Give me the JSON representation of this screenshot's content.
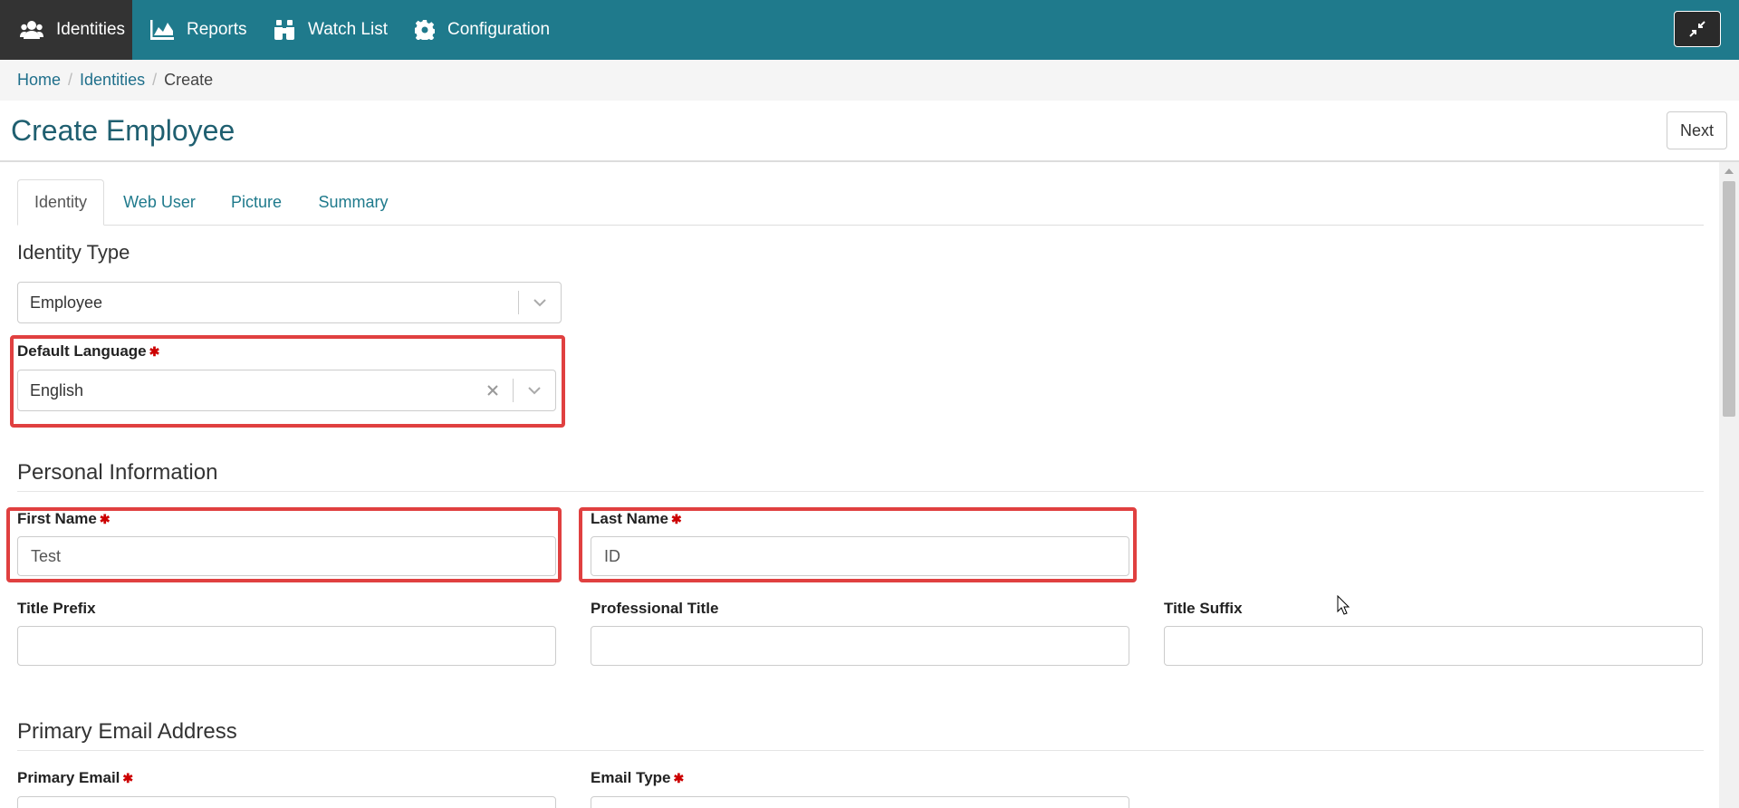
{
  "nav": {
    "items": [
      {
        "label": "Identities",
        "icon": "users-icon"
      },
      {
        "label": "Reports",
        "icon": "area-chart-icon"
      },
      {
        "label": "Watch List",
        "icon": "binoculars-icon"
      },
      {
        "label": "Configuration",
        "icon": "gear-icon"
      }
    ],
    "collapse_icon": "compress-icon"
  },
  "breadcrumb": {
    "home": "Home",
    "identities": "Identities",
    "current": "Create",
    "separator": "/"
  },
  "page": {
    "title": "Create Employee",
    "next_label": "Next"
  },
  "tabs": [
    "Identity",
    "Web User",
    "Picture",
    "Summary"
  ],
  "identity_type": {
    "title": "Identity Type",
    "value": "Employee"
  },
  "default_language": {
    "label": "Default Language",
    "required": "✱",
    "value": "English"
  },
  "personal": {
    "title": "Personal Information",
    "first_name_label": "First Name",
    "first_name_value": "Test",
    "last_name_label": "Last Name",
    "last_name_value": "ID",
    "title_prefix_label": "Title Prefix",
    "professional_title_label": "Professional Title",
    "title_suffix_label": "Title Suffix"
  },
  "email": {
    "title": "Primary Email Address",
    "primary_email_label": "Primary Email",
    "email_type_label": "Email Type"
  },
  "colors": {
    "nav_bg": "#1f7a8c",
    "nav_active": "#333333",
    "title": "#1f5f70",
    "highlight": "#e04040",
    "required": "#cc0000"
  }
}
